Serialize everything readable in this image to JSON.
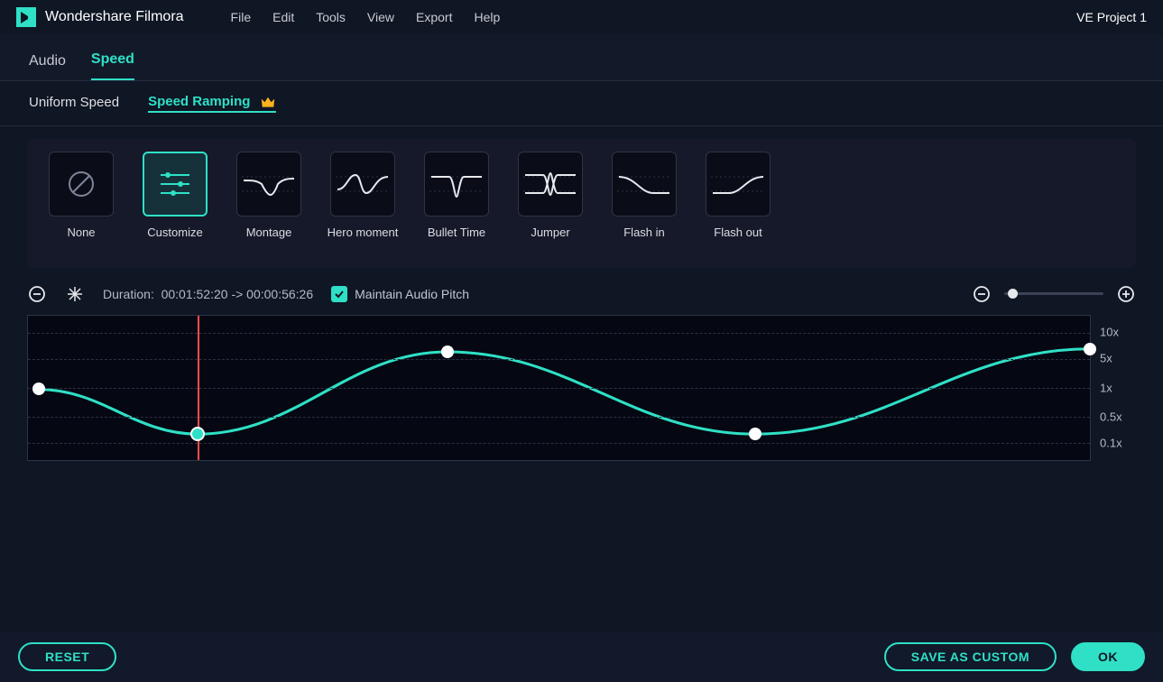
{
  "app": {
    "brand": "Wondershare Filmora",
    "project": "VE Project 1",
    "menu": [
      "File",
      "Edit",
      "Tools",
      "View",
      "Export",
      "Help"
    ]
  },
  "panel_tabs": {
    "items": [
      "Audio",
      "Speed"
    ],
    "active": 1
  },
  "sub_tabs": {
    "items": [
      "Uniform Speed",
      "Speed Ramping"
    ],
    "active": 1
  },
  "presets": [
    {
      "id": "none",
      "label": "None"
    },
    {
      "id": "customize",
      "label": "Customize"
    },
    {
      "id": "montage",
      "label": "Montage"
    },
    {
      "id": "hero",
      "label": "Hero moment"
    },
    {
      "id": "bullet",
      "label": "Bullet Time"
    },
    {
      "id": "jumper",
      "label": "Jumper"
    },
    {
      "id": "flashin",
      "label": "Flash in"
    },
    {
      "id": "flashout",
      "label": "Flash out"
    }
  ],
  "preset_selected": "customize",
  "toolbar": {
    "duration_label": "Duration:",
    "duration_value": "00:01:52:20 -> 00:00:56:26",
    "maintain_pitch": "Maintain Audio Pitch",
    "maintain_pitch_checked": true
  },
  "graph": {
    "y_ticks": [
      "10x",
      "5x",
      "1x",
      "0.5x",
      "0.1x"
    ],
    "y_tick_pos_pct": [
      12,
      30,
      50,
      70,
      88
    ],
    "playhead_pct": 16,
    "control_points": [
      {
        "x_pct": 1,
        "y_pct": 51,
        "selected": false
      },
      {
        "x_pct": 16,
        "y_pct": 82,
        "selected": true
      },
      {
        "x_pct": 39.5,
        "y_pct": 25,
        "selected": false
      },
      {
        "x_pct": 68.5,
        "y_pct": 82,
        "selected": false
      },
      {
        "x_pct": 100,
        "y_pct": 23,
        "selected": false
      }
    ]
  },
  "footer": {
    "reset": "RESET",
    "save_custom": "SAVE AS CUSTOM",
    "ok": "OK"
  }
}
